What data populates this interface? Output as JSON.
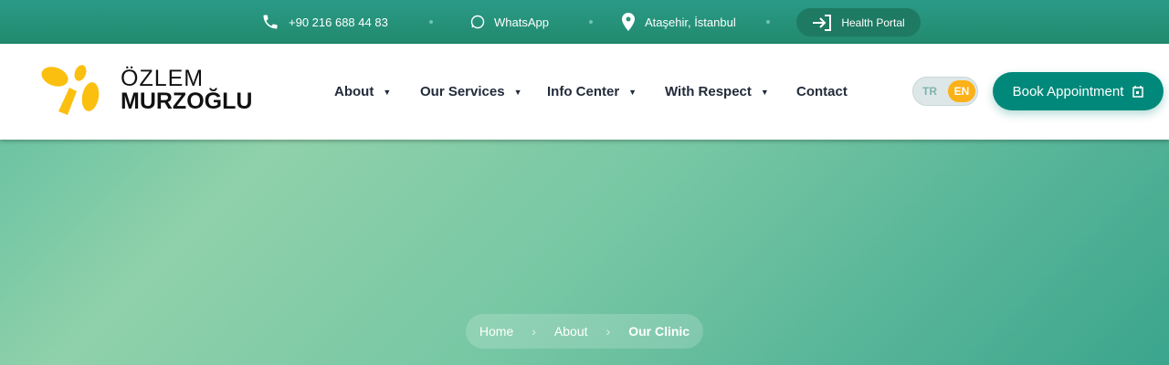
{
  "topbar": {
    "phone": "+90 216 688 44 83",
    "whatsapp": "WhatsApp",
    "location": "Ataşehir, İstanbul",
    "portal": "Health Portal"
  },
  "logo": {
    "line1": "ÖZLEM",
    "line2": "MURZOĞLU",
    "color": "#fbbf0f"
  },
  "nav": {
    "items": [
      {
        "label": "About"
      },
      {
        "label": "Our Services"
      },
      {
        "label": "Info Center"
      },
      {
        "label": "With Respect"
      },
      {
        "label": "Contact"
      }
    ]
  },
  "lang": {
    "tr": "TR",
    "en": "EN",
    "active": "EN"
  },
  "book": {
    "label": "Book Appointment"
  },
  "breadcrumb": {
    "home": "Home",
    "about": "About",
    "current": "Our Clinic"
  },
  "colors": {
    "primary": "#00897a",
    "accent": "#fbb117"
  }
}
